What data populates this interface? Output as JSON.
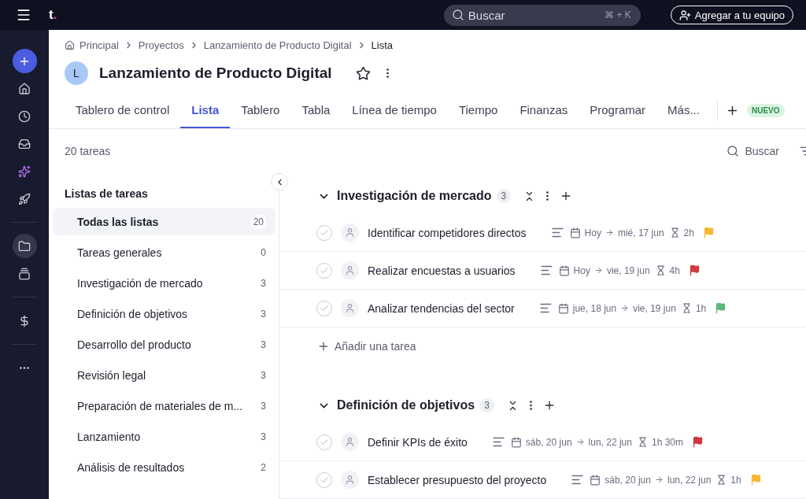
{
  "topbar": {
    "logo": {
      "letter": "t",
      "dot": "."
    },
    "search": {
      "placeholder": "Buscar",
      "shortcut": "⌘ + K"
    },
    "invite_button": "Agregar a tu equipo"
  },
  "rail": [
    {
      "kind": "create"
    },
    {
      "kind": "home",
      "selected": false
    },
    {
      "kind": "recent",
      "selected": false
    },
    {
      "kind": "inbox",
      "selected": false
    },
    {
      "kind": "ai",
      "selected": false
    },
    {
      "kind": "rocket",
      "selected": false
    },
    {
      "kind": "divider"
    },
    {
      "kind": "projects",
      "selected": true
    },
    {
      "kind": "gallery",
      "selected": false
    },
    {
      "kind": "divider"
    },
    {
      "kind": "finance",
      "selected": false
    },
    {
      "kind": "divider"
    },
    {
      "kind": "more",
      "selected": false
    }
  ],
  "breadcrumb": [
    "Principal",
    "Proyectos",
    "Lanzamiento de Producto Digital",
    "Lista"
  ],
  "project": {
    "avatar": "L",
    "title": "Lanzamiento de Producto Digital"
  },
  "tabs": [
    {
      "label": "Tablero de control",
      "selected": false
    },
    {
      "label": "Lista",
      "selected": true
    },
    {
      "label": "Tablero",
      "selected": false
    },
    {
      "label": "Tabla",
      "selected": false
    },
    {
      "label": "Línea de tiempo",
      "selected": false
    },
    {
      "label": "Tiempo",
      "selected": false
    },
    {
      "label": "Finanzas",
      "selected": false
    },
    {
      "label": "Programar",
      "selected": false
    },
    {
      "label": "Más...",
      "selected": false
    }
  ],
  "new_badge": "NUEVO",
  "task_count": "20 tareas",
  "search_label": "Buscar",
  "lists": {
    "title": "Listas de tareas",
    "items": [
      {
        "name": "Todas las listas",
        "count": "20",
        "selected": true
      },
      {
        "name": "Tareas generales",
        "count": "0",
        "selected": false
      },
      {
        "name": "Investigación de mercado",
        "count": "3",
        "selected": false
      },
      {
        "name": "Definición de objetivos",
        "count": "3",
        "selected": false
      },
      {
        "name": "Desarrollo del producto",
        "count": "3",
        "selected": false
      },
      {
        "name": "Revisión legal",
        "count": "3",
        "selected": false
      },
      {
        "name": "Preparación de materiales de m...",
        "count": "3",
        "selected": false
      },
      {
        "name": "Lanzamiento",
        "count": "3",
        "selected": false
      },
      {
        "name": "Análisis de resultados",
        "count": "2",
        "selected": false
      }
    ]
  },
  "groups": [
    {
      "title": "Investigación de mercado",
      "count": "3",
      "add_task": "Añadir una tarea",
      "tasks": [
        {
          "done": false,
          "name": "Identificar competidores directos",
          "start": "Hoy",
          "end": "mié, 17 jun",
          "duration": "2h",
          "color": "#f5b731"
        },
        {
          "done": false,
          "name": "Realizar encuestas a usuarios",
          "start": "Hoy",
          "end": "vie, 19 jun",
          "duration": "4h",
          "color": "#d0393b"
        },
        {
          "done": false,
          "name": "Analizar tendencias del sector",
          "start": "jue, 18 jun",
          "end": "vie, 19 jun",
          "duration": "1h",
          "color": "#5cb87c"
        }
      ]
    },
    {
      "title": "Definición de objetivos",
      "count": "3",
      "tasks": [
        {
          "done": false,
          "name": "Definir KPIs de éxito",
          "start": "sáb, 20 jun",
          "end": "lun, 22 jun",
          "duration": "1h 30m",
          "color": "#d0393b"
        },
        {
          "done": false,
          "name": "Establecer presupuesto del proyecto",
          "start": "sáb, 20 jun",
          "end": "lun, 22 jun",
          "duration": "1h",
          "color": "#f5b731"
        }
      ]
    }
  ]
}
